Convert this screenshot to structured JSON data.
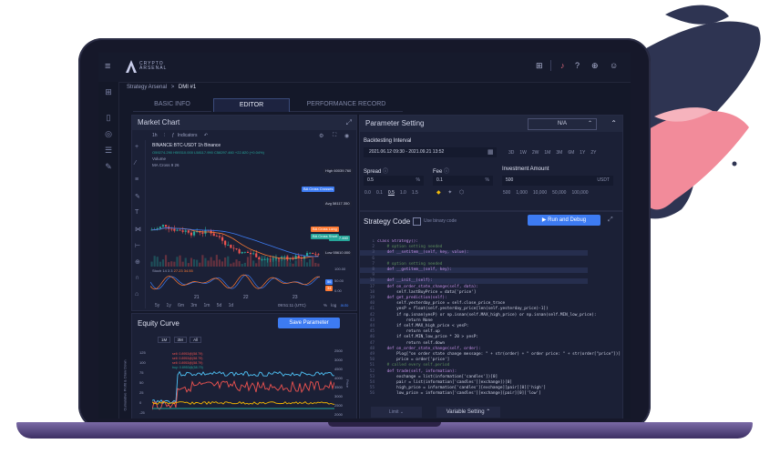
{
  "colors": {
    "accent_blue": "#3d7bf2",
    "green": "#26a69a",
    "red": "#ef5350",
    "deco_navy": "#2e3452",
    "deco_pink": "#f28b9a"
  },
  "app": {
    "logo_text": "CRYPTO ARSENAL"
  },
  "topbar": {
    "icons": [
      "grid-icon",
      "bell-icon",
      "help-icon",
      "globe-icon",
      "user-icon"
    ]
  },
  "breadcrumb": {
    "root": "Strategy Arsenal",
    "separator": ">",
    "current": "DMI #1"
  },
  "tabs": [
    "BASIC INFO",
    "EDITOR",
    "PERFORMANCE RECORD"
  ],
  "active_tab": "EDITOR",
  "market_chart": {
    "title": "Market Chart",
    "toolbar": {
      "interval": "1h",
      "indicators_label": "Indicators"
    },
    "symbol_line": "BINANCE:BTC-USDT  1h  Binance",
    "ohlc_line": "O59274.290 H59310.000 L58117.990 C58297.460 +22.820 (+0.04%)",
    "volume_label": "Volume",
    "ma_label": "MA Cross 9 26",
    "price_tags": [
      {
        "text": "High",
        "value": "60039.760",
        "color": "#1e2235"
      },
      {
        "text": "BA Cross Crosses",
        "value": "",
        "color": "#3d7bf2"
      },
      {
        "text": "Avg",
        "value": "58117.350",
        "color": "#1e2235"
      },
      {
        "text": "BA Cross Long",
        "value": "",
        "color": "#ff7a33"
      },
      {
        "text": "BA Cross Short",
        "value": "",
        "color": "#26a69a"
      },
      {
        "text": "",
        "value": "56397.460",
        "color": "#26a69a"
      },
      {
        "text": "Low",
        "value": "55610.000",
        "color": "#1e2235"
      }
    ],
    "stoch_label": "Stoch 14 3 3",
    "stoch_values": "27.23  34.55",
    "stoch_axis": [
      "100.00",
      "50.00",
      "0.00"
    ],
    "x_ticks": [
      "21",
      "22",
      "23"
    ],
    "ranges": [
      "5y",
      "1y",
      "6m",
      "3m",
      "1m",
      "5d",
      "1d"
    ],
    "time": "09:51:11 (UTC)",
    "scale_opts": [
      "%",
      "log",
      "auto"
    ]
  },
  "equity_curve": {
    "title": "Equity Curve",
    "save_label": "Save Parameter",
    "ranges": [
      "1M",
      "3M",
      "All"
    ],
    "y_left": [
      "125",
      "100",
      "75",
      "50",
      "25",
      "0",
      "-25"
    ],
    "y_right": [
      "2500",
      "3000",
      "4500",
      "4000",
      "3500",
      "3000",
      "2500",
      "2000"
    ],
    "left_label": "Cumulative Profit & Draw Down",
    "right_label": "Price",
    "annotations": [
      "sell: 0.8953@(58.79)",
      "sell: 0.8953@(58.79)",
      "sell: 0.8953@(58.79)",
      "buy: 0.8953@(58.79)"
    ]
  },
  "parameter_setting": {
    "title": "Parameter Setting",
    "select_value": "N/A",
    "backtesting_label": "Backtesting Interval",
    "interval_value": "2021.06.12 09:30 - 2021.09.21 13:52",
    "presets": [
      "3D",
      "1W",
      "2W",
      "1M",
      "3M",
      "6M",
      "1Y",
      "2Y"
    ],
    "spread_label": "Spread",
    "spread_value": "0.5",
    "spread_unit": "%",
    "spread_presets": [
      "0.0",
      "0.1",
      "0.5",
      "1.0",
      "1.5"
    ],
    "fee_label": "Fee",
    "fee_value": "0.1",
    "fee_unit": "%",
    "investment_label": "Investment Amount",
    "investment_value": "500",
    "investment_unit": "USDT",
    "investment_presets": [
      "500",
      "1,000",
      "10,000",
      "50,000",
      "100,000"
    ]
  },
  "strategy_code": {
    "title": "Strategy Code",
    "binary_label": "Use binary code",
    "run_label": "Run and Debug",
    "lines": [
      {
        "n": "1",
        "t": "class Strategy():",
        "hl": false
      },
      {
        "n": "2",
        "t": "    # option setting needed",
        "hl": false
      },
      {
        "n": "3",
        "t": "    def __setitem__(self, key, value):",
        "hl": true
      },
      {
        "n": "6",
        "t": "",
        "hl": false
      },
      {
        "n": "7",
        "t": "    # option setting needed",
        "hl": false
      },
      {
        "n": "8",
        "t": "    def __getitem__(self, key):",
        "hl": true
      },
      {
        "n": "9",
        "t": "",
        "hl": false
      },
      {
        "n": "10",
        "t": "    def __init__(self):",
        "hl": true
      },
      {
        "n": "17",
        "t": "    def on_order_state_change(self, data):",
        "hl": false
      },
      {
        "n": "18",
        "t": "        self.lastBuyPrice = data['price']",
        "hl": false
      },
      {
        "n": "19",
        "t": "    def get_prediction(self):",
        "hl": false
      },
      {
        "n": "40",
        "t": "        self.yesterday_price = self.close_price_trace",
        "hl": false
      },
      {
        "n": "41",
        "t": "        yesP = float(self.yesterday_price[len(self.yesterday_price)-1])",
        "hl": false
      },
      {
        "n": "42",
        "t": "        if np.isnan(yesP) or np.isnan(self.MAX_high_price) or np.isnan(self.MIN_low_price):",
        "hl": false
      },
      {
        "n": "43",
        "t": "            return None",
        "hl": false
      },
      {
        "n": "44",
        "t": "        if self.MAX_high_price < yesP:",
        "hl": false
      },
      {
        "n": "45",
        "t": "            return self.up",
        "hl": false
      },
      {
        "n": "46",
        "t": "        if self.MIN_low_price * 20 > yesP:",
        "hl": false
      },
      {
        "n": "47",
        "t": "            return self.down",
        "hl": false
      },
      {
        "n": "48",
        "t": "    def on_order_state_change(self, order):",
        "hl": false
      },
      {
        "n": "49",
        "t": "        Plog[\"on order state change message: \" + str(order) + \" order price: \" + str(order[\"price\"])]",
        "hl": false
      },
      {
        "n": "50",
        "t": "        price = order['price']",
        "hl": false
      },
      {
        "n": "51",
        "t": "    # called every self.period",
        "hl": false
      },
      {
        "n": "52",
        "t": "    def trade(self, information):",
        "hl": false
      },
      {
        "n": "53",
        "t": "        exchange = list(information['candles'])[0]",
        "hl": false
      },
      {
        "n": "54",
        "t": "        pair = list(information['candles'][exchange])[0]",
        "hl": false
      },
      {
        "n": "55",
        "t": "        high_price = information['candles'][exchange][pair][0]['high']",
        "hl": false
      },
      {
        "n": "56",
        "t": "        low_price = information['candles'][exchange][pair][0]['low']",
        "hl": false
      }
    ],
    "footer_left": "Limit",
    "footer_right": "Variable Setting"
  }
}
